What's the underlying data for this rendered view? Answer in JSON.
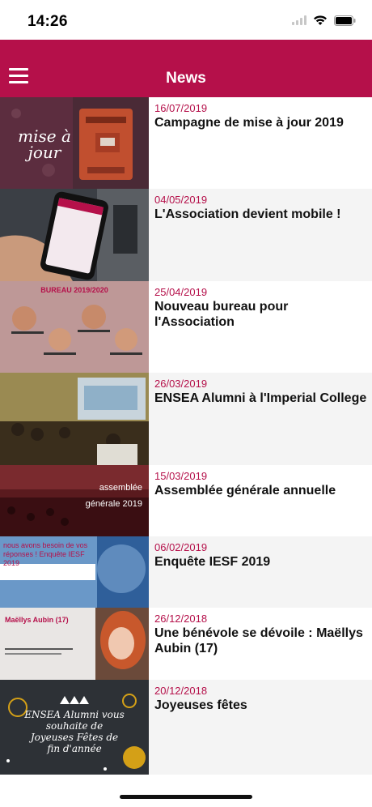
{
  "status_bar": {
    "time": "14:26",
    "icons": [
      "signal-icon",
      "wifi-icon",
      "battery-icon"
    ]
  },
  "header": {
    "title": "News",
    "menu_icon": "hamburger-menu-icon",
    "color": "#b5104a"
  },
  "news": [
    {
      "date": "16/07/2019",
      "title": "Campagne de mise à jour 2019",
      "image_text": "mise à jour"
    },
    {
      "date": "04/05/2019",
      "title": "L'Association devient mobile !"
    },
    {
      "date": "25/04/2019",
      "title": "Nouveau bureau pour l'Association",
      "image_text": "BUREAU 2019/2020"
    },
    {
      "date": "26/03/2019",
      "title": "ENSEA Alumni à l'Imperial College"
    },
    {
      "date": "15/03/2019",
      "title": "Assemblée générale annuelle",
      "image_text": "assemblée générale 2019"
    },
    {
      "date": "06/02/2019",
      "title": "Enquête IESF 2019",
      "image_text": "nous avons besoin de vos réponses ! Enquête IESF 2019"
    },
    {
      "date": "26/12/2018",
      "title": "Une bénévole se dévoile : Maëllys Aubin (17)",
      "image_text": "Maëllys Aubin (17)"
    },
    {
      "date": "20/12/2018",
      "title": "Joyeuses fêtes",
      "image_text": "ENSEA Alumni vous souhaite de Joyeuses Fêtes de fin d'année"
    }
  ]
}
